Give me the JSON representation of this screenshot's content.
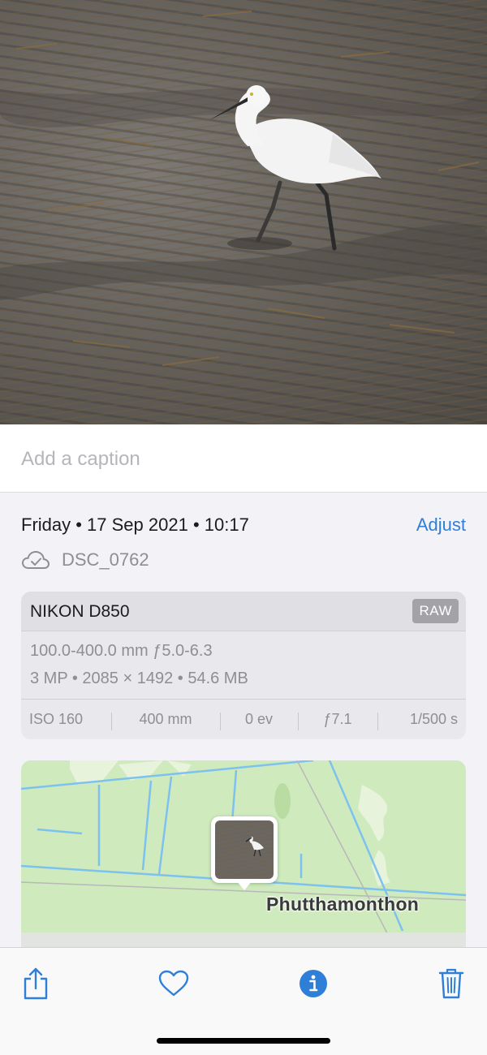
{
  "photo": {
    "subject": "egret"
  },
  "caption": {
    "placeholder": "Add a caption"
  },
  "info": {
    "date_line": "Friday • 17 Sep 2021 • 10:17",
    "adjust_label": "Adjust",
    "file_name": "DSC_0762",
    "sync_icon": "cloud-check-icon"
  },
  "camera": {
    "name": "NIKON D850",
    "format_badge": "RAW",
    "lens": "100.0-400.0 mm ƒ5.0-6.3",
    "specs": "3 MP  •  2085 × 1492  •  54.6 MB",
    "exif": {
      "iso": "ISO 160",
      "focal_length": "400 mm",
      "exposure_bias": "0 ev",
      "aperture": "ƒ7.1",
      "shutter": "1/500 s"
    }
  },
  "map": {
    "place": "Phutthamonthon"
  },
  "toolbar": {
    "share_icon": "share-icon",
    "favorite_icon": "heart-icon",
    "info_icon": "info-icon",
    "delete_icon": "trash-icon"
  },
  "colors": {
    "accent": "#2f7fd8",
    "secondary_text": "#8e8e93",
    "background": "#f2f2f7",
    "map_land": "#cfeabd",
    "map_water": "#7dc2ef"
  }
}
